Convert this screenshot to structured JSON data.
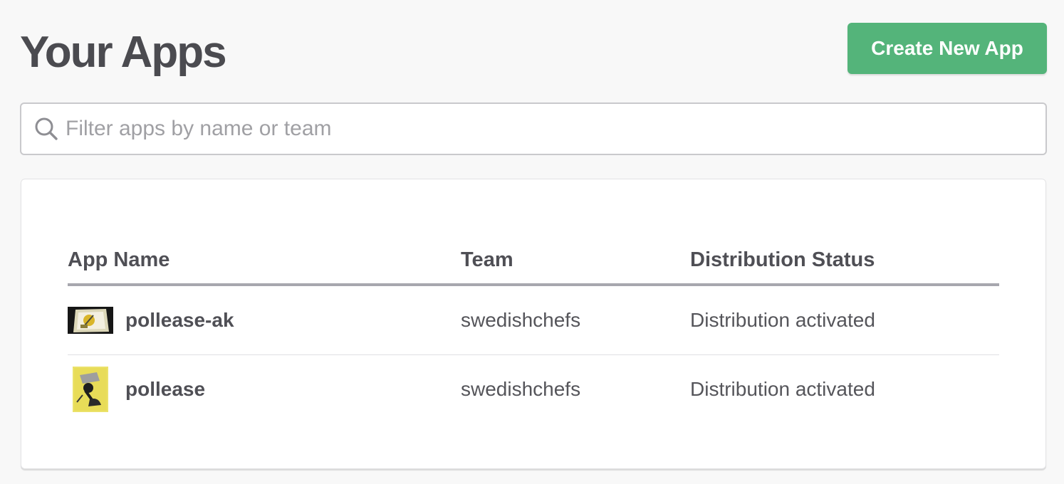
{
  "page": {
    "title": "Your Apps"
  },
  "create_button": {
    "label": "Create New App",
    "color": "#54b47a"
  },
  "search": {
    "placeholder": "Filter apps by name or team",
    "value": "",
    "icon": "search-icon"
  },
  "table": {
    "headers": {
      "app_name": "App Name",
      "team": "Team",
      "status": "Distribution Status"
    },
    "rows": [
      {
        "icon": "app-thumbnail-icon",
        "name": "pollease-ak",
        "team": "swedishchefs",
        "status": "Distribution activated"
      },
      {
        "icon": "app-thumbnail-icon",
        "name": "pollease",
        "team": "swedishchefs",
        "status": "Distribution activated"
      }
    ]
  }
}
